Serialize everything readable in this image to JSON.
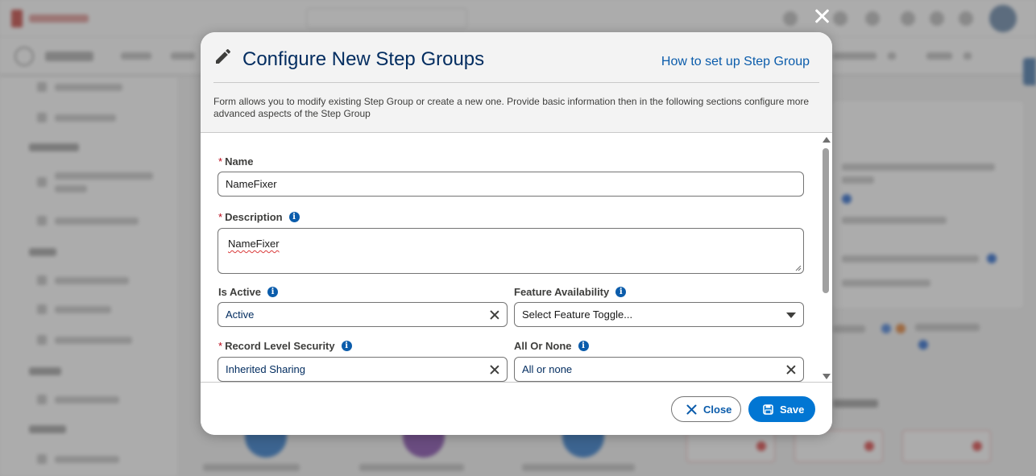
{
  "modal": {
    "title": "Configure New Step Groups",
    "help_link": "How to set up Step Group",
    "description": "Form allows you to modify existing Step Group or create a new one. Provide basic information then in the following sections configure more advanced aspects of the Step Group"
  },
  "form": {
    "name_label": "Name",
    "name_value": "NameFixer",
    "description_label": "Description",
    "description_value": "NameFixer",
    "is_active_label": "Is Active",
    "is_active_value": "Active",
    "feature_label": "Feature Availability",
    "feature_placeholder": "Select Feature Toggle...",
    "rls_label": "Record Level Security",
    "rls_value": "Inherited Sharing",
    "all_or_none_label": "All Or None",
    "all_or_none_value": "All or none",
    "required_marker": "*"
  },
  "footer": {
    "close_label": "Close",
    "save_label": "Save"
  },
  "colors": {
    "title": "#032d60",
    "link": "#0b5cab",
    "brand": "#0176d3",
    "required": "#ba0517"
  },
  "icons": [
    "pencil-icon",
    "info-icon",
    "close-icon",
    "clear-icon",
    "chevron-down-icon",
    "save-icon"
  ]
}
